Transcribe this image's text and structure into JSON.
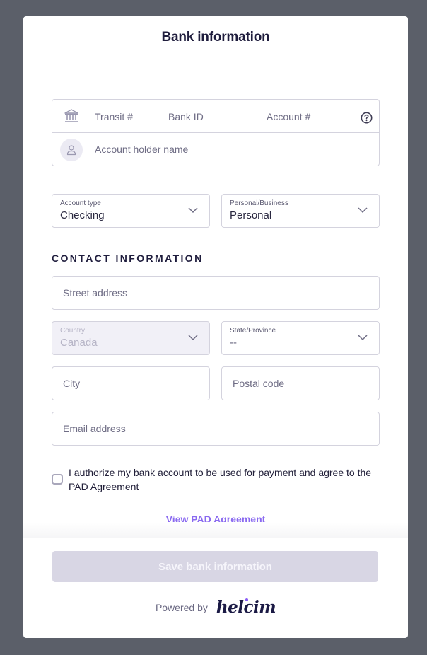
{
  "header": {
    "title": "Bank information"
  },
  "bank": {
    "transit_placeholder": "Transit #",
    "bank_id_placeholder": "Bank ID",
    "account_placeholder": "Account #",
    "holder_placeholder": "Account holder name",
    "icons": {
      "bank": "bank-building-icon",
      "help": "question-circle-icon",
      "holder": "user-icon"
    }
  },
  "account_type": {
    "label": "Account type",
    "value": "Checking"
  },
  "personal_business": {
    "label": "Personal/Business",
    "value": "Personal"
  },
  "contact": {
    "section_title": "CONTACT INFORMATION",
    "street_placeholder": "Street address",
    "country": {
      "label": "Country",
      "value": "Canada",
      "disabled": true
    },
    "state": {
      "label": "State/Province",
      "value": "--"
    },
    "city_placeholder": "City",
    "postal_placeholder": "Postal code",
    "email_placeholder": "Email address"
  },
  "agreement": {
    "checkbox_label": "I authorize my bank account to be used for payment and agree to the PAD Agreement",
    "checked": false,
    "link_label": "View PAD Agreement"
  },
  "footer": {
    "save_label": "Save bank information",
    "powered_by": "Powered by",
    "brand": "helcim"
  },
  "colors": {
    "accent": "#8a6af0",
    "title": "#1f1d3d",
    "disabled_button": "#d8d6e4",
    "backdrop": "#5b5f69"
  }
}
